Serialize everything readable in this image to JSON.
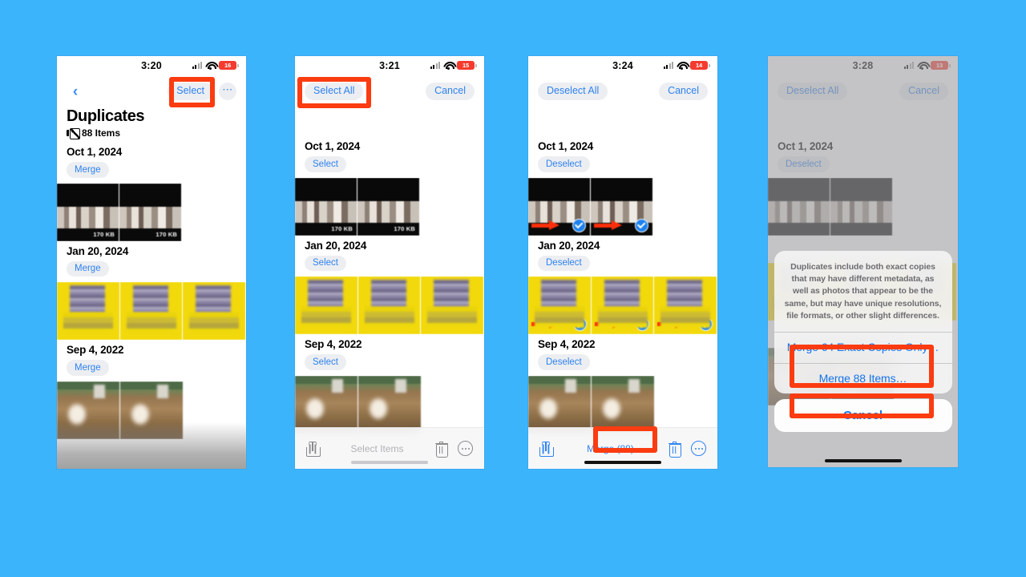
{
  "background_color": "#3cb4fc",
  "accent_blue": "#2f82ef",
  "annotation_red": "#fb3c10",
  "panels": [
    {
      "id": "panel-browse",
      "status": {
        "time": "3:20",
        "battery": "16",
        "signal_icon": "cellular-signal-icon",
        "wifi_icon": "wifi-icon",
        "battery_icon": "battery-icon"
      },
      "nav": {
        "back_icon": "back-chevron-icon",
        "select_label": "Select",
        "more_icon": "more-options-icon"
      },
      "title": "Duplicates",
      "count_label": "88 Items",
      "count_icon": "photo-stack-icon",
      "groups": [
        {
          "date": "Oct 1, 2024",
          "action": "Merge",
          "photos": [
            {
              "size": "170 KB"
            },
            {
              "size": "170 KB"
            }
          ]
        },
        {
          "date": "Jan 20, 2024",
          "action": "Merge",
          "photos": [
            {
              "size": ""
            },
            {
              "size": ""
            },
            {
              "size": ""
            }
          ]
        },
        {
          "date": "Sep 4, 2022",
          "action": "Merge",
          "photos": [
            {
              "size": ""
            },
            {
              "size": ""
            }
          ]
        }
      ]
    },
    {
      "id": "panel-select-mode",
      "status": {
        "time": "3:21",
        "battery": "15"
      },
      "nav": {
        "select_all_label": "Select All",
        "cancel_label": "Cancel"
      },
      "groups": [
        {
          "date": "Oct 1, 2024",
          "action": "Select"
        },
        {
          "date": "Jan 20, 2024",
          "action": "Select"
        },
        {
          "date": "Sep 4, 2022",
          "action": "Select"
        }
      ],
      "toolbar": {
        "share_icon": "share-icon",
        "center_label": "Select Items",
        "trash_icon": "trash-icon",
        "more_icon": "more-options-icon"
      }
    },
    {
      "id": "panel-all-selected",
      "status": {
        "time": "3:24",
        "battery": "14"
      },
      "nav": {
        "deselect_all_label": "Deselect All",
        "cancel_label": "Cancel"
      },
      "groups": [
        {
          "date": "Oct 1, 2024",
          "action": "Deselect"
        },
        {
          "date": "Jan 20, 2024",
          "action": "Deselect"
        },
        {
          "date": "Sep 4, 2022",
          "action": "Deselect"
        }
      ],
      "toolbar": {
        "share_icon": "share-icon",
        "center_label": "Merge (88)",
        "trash_icon": "trash-icon",
        "more_icon": "more-options-icon"
      }
    },
    {
      "id": "panel-merge-dialog",
      "status": {
        "time": "3:28",
        "battery": "13"
      },
      "nav": {
        "deselect_all_label": "Deselect All",
        "cancel_label": "Cancel"
      },
      "groups": [
        {
          "date": "Oct 1, 2024",
          "action": "Deselect"
        }
      ],
      "alert": {
        "message": "Duplicates include both exact copies that may have different metadata, as well as photos that appear to be the same, but may have unique resolutions, file formats, or other slight differences.",
        "option_exact": "Merge 64 Exact Copies Only…",
        "option_all": "Merge 88 Items…",
        "cancel": "Cancel"
      }
    }
  ]
}
